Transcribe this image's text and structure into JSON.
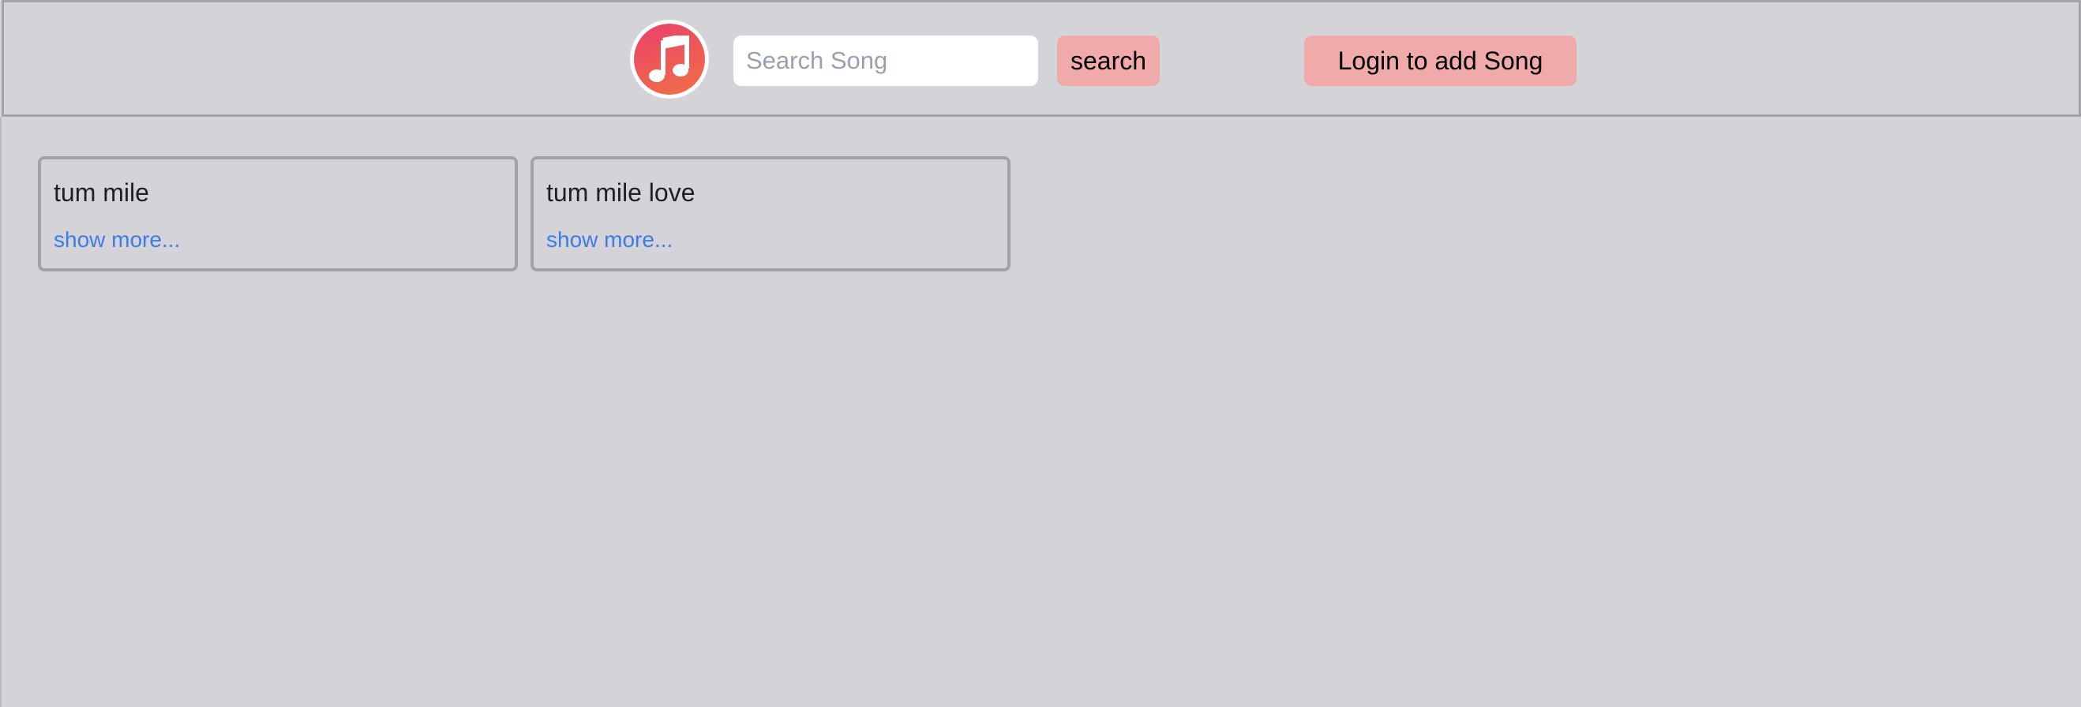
{
  "header": {
    "logo_icon": "music-note-icon",
    "search": {
      "placeholder": "Search Song",
      "value": ""
    },
    "search_button_label": "search",
    "login_button_label": "Login to add Song"
  },
  "songs": [
    {
      "title": "tum mile",
      "link_label": "show more..."
    },
    {
      "title": "tum mile love",
      "link_label": "show more..."
    }
  ],
  "colors": {
    "background": "#d4d3d8",
    "border": "#a3a2a7",
    "button": "#f0aaa9",
    "link": "#3d7be8",
    "logo_gradient_start": "#ea3f6d",
    "logo_gradient_end": "#f0704a"
  }
}
